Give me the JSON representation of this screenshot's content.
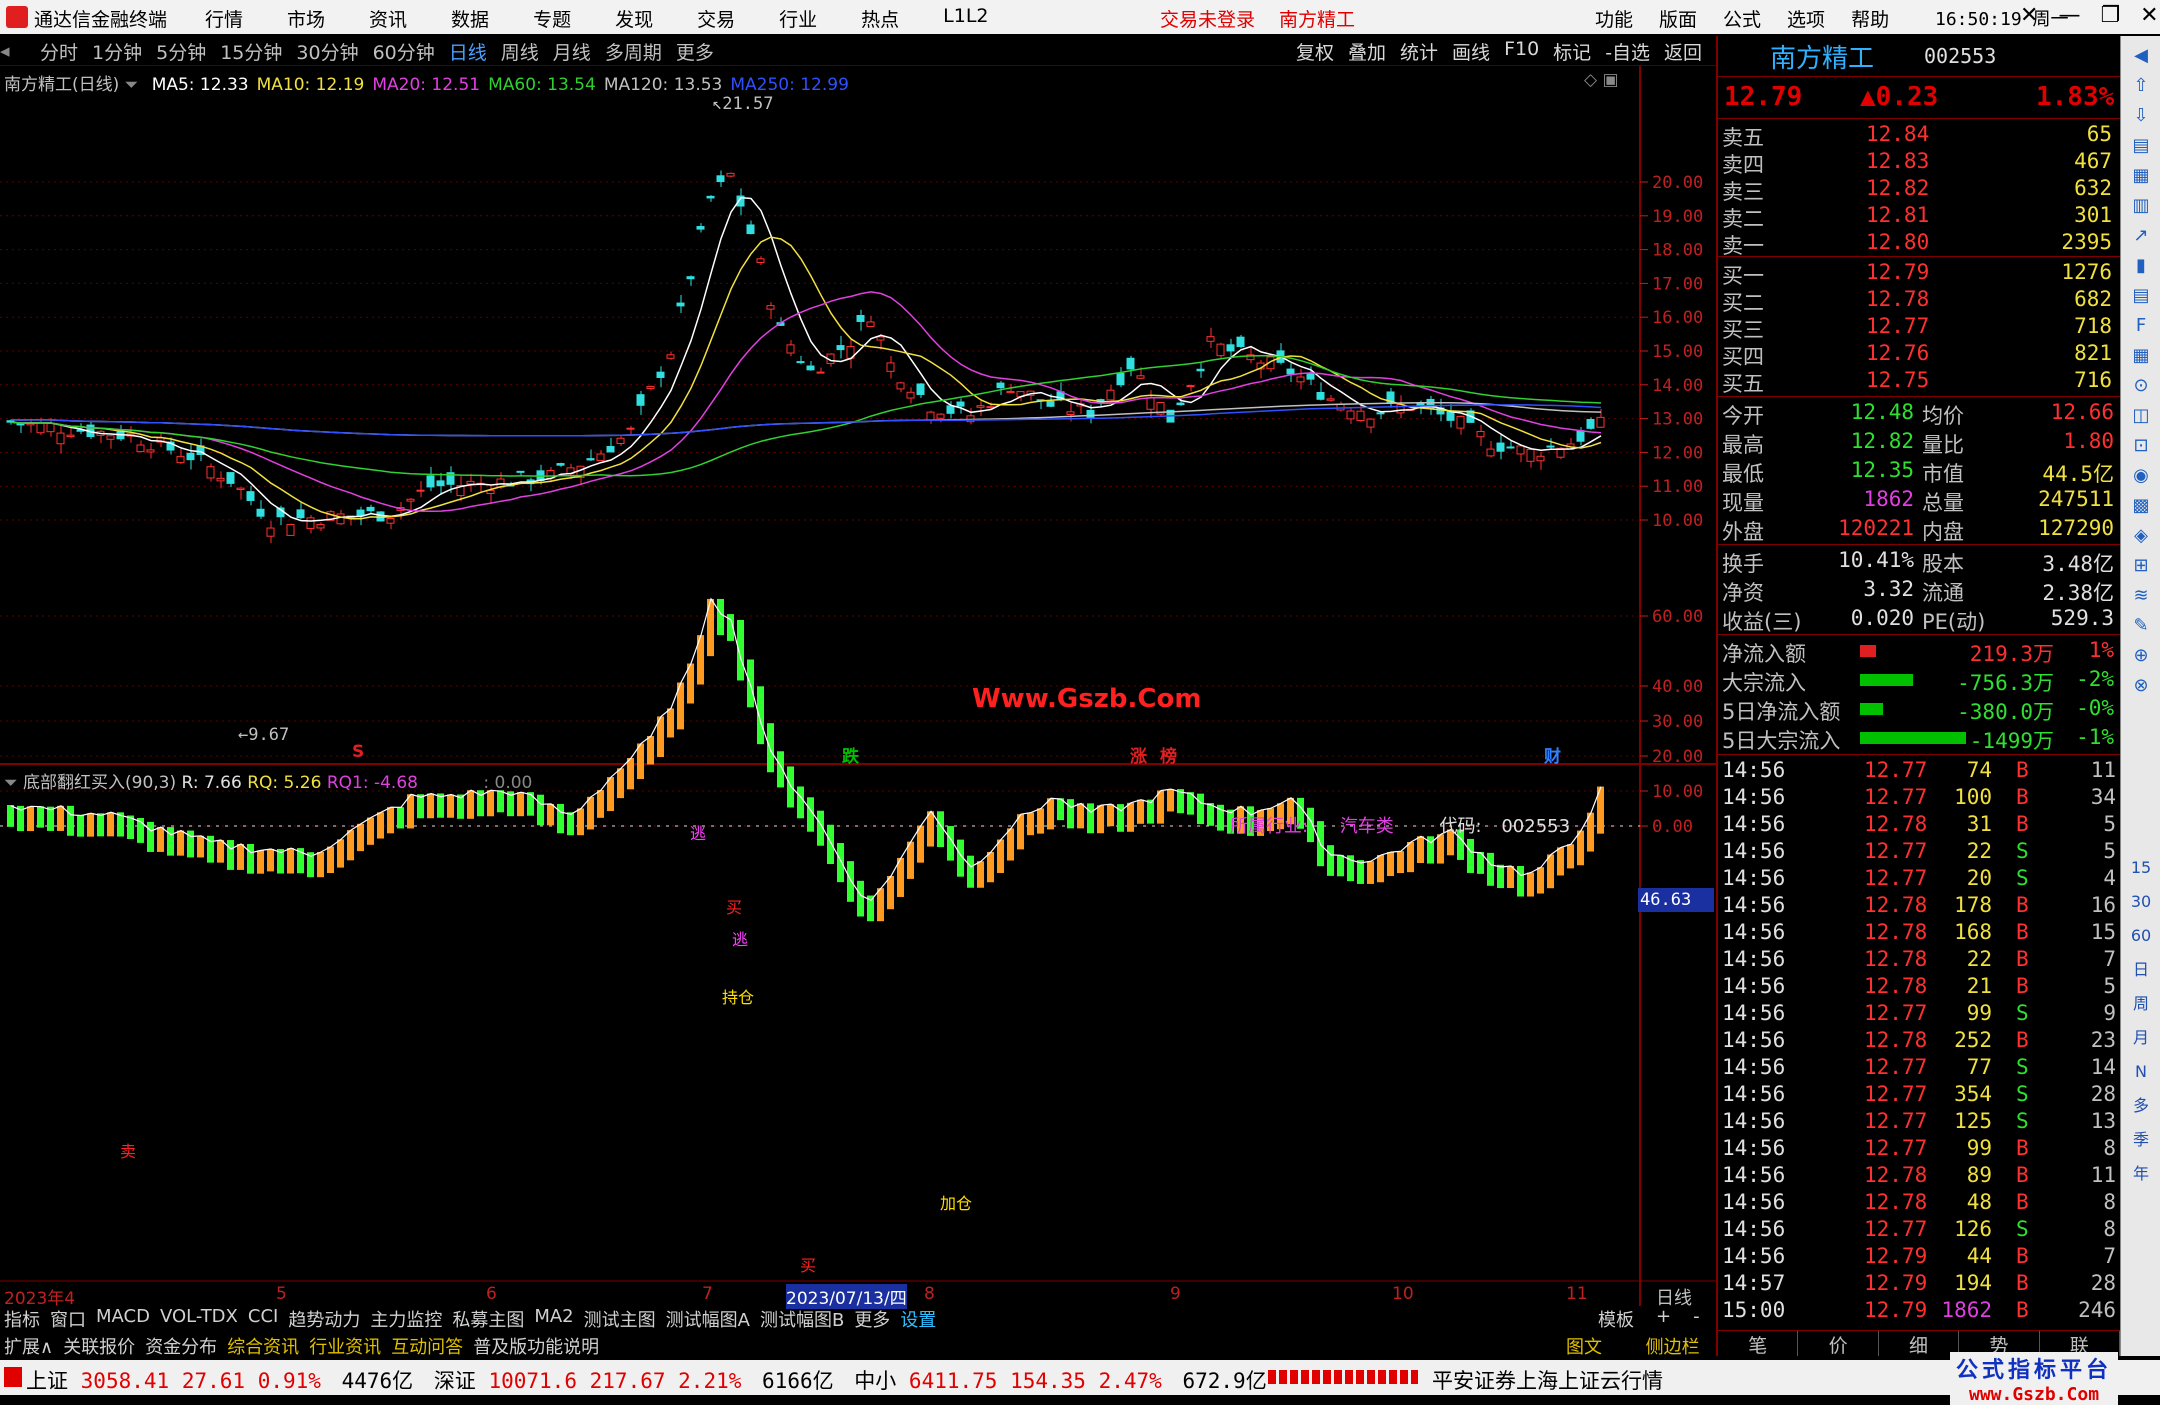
{
  "titlebar": {
    "app": "通达信金融终端",
    "menu": [
      "行情",
      "市场",
      "资讯",
      "数据",
      "专题",
      "发现",
      "交易",
      "行业",
      "热点",
      "L1L2"
    ],
    "login_status": "交易未登录",
    "stock_name": "南方精工",
    "right_menu": [
      "功能",
      "版面",
      "公式",
      "选项",
      "帮助"
    ],
    "clock": "16:50:19",
    "weekday": "周一"
  },
  "periods": {
    "items": [
      "分时",
      "1分钟",
      "5分钟",
      "15分钟",
      "30分钟",
      "60分钟",
      "日线",
      "周线",
      "月线",
      "多周期",
      "更多"
    ],
    "active": "日线",
    "tools": [
      "复权",
      "叠加",
      "统计",
      "画线",
      "F10",
      "标记",
      "-自选",
      "返回"
    ]
  },
  "main_chart": {
    "title": "南方精工(日线)",
    "ma": [
      {
        "label": "MA5: 12.33",
        "color": "#ffffff"
      },
      {
        "label": "MA10: 12.19",
        "color": "#f0e040"
      },
      {
        "label": "MA20: 12.51",
        "color": "#e040e0"
      },
      {
        "label": "MA60: 13.54",
        "color": "#30d030"
      },
      {
        "label": "MA120: 13.53",
        "color": "#c0c0c0"
      },
      {
        "label": "MA250: 12.99",
        "color": "#3050ff"
      }
    ],
    "high_mark": "21.57",
    "low_mark": "9.67",
    "watermark": "Www.Gszb.Com",
    "yticks": [
      "20.00",
      "19.00",
      "18.00",
      "17.00",
      "16.00",
      "15.00",
      "14.00",
      "13.00",
      "12.00",
      "11.00",
      "10.00"
    ],
    "event_marks": [
      {
        "text": "S",
        "color": "#e02020"
      },
      {
        "text": "跌",
        "color": "#00c000"
      },
      {
        "text": "涨",
        "color": "#e02020"
      },
      {
        "text": "榜",
        "color": "#e02020"
      },
      {
        "text": "财",
        "color": "#3080ff"
      }
    ]
  },
  "indicator": {
    "name": "底部翻红买入(90,3)",
    "r": "R: 7.66",
    "rq": "RQ: 5.26",
    "rq1": "RQ1: -4.68",
    "zero": ": 0.00",
    "industry_label": "所属行业:",
    "industry": "汽车类",
    "code_label": "代码:",
    "code": "002553",
    "current": "46.63",
    "yticks": [
      "60.00",
      "40.00",
      "30.00",
      "20.00",
      "10.00",
      "0.00"
    ],
    "labels": [
      "逃",
      "买",
      "逃",
      "持仓",
      "加仓",
      "卖",
      "买"
    ]
  },
  "time_axis": {
    "labels": [
      "2023年4",
      "5",
      "6",
      "7",
      "2023/07/13/四",
      "8",
      "9",
      "10",
      "11"
    ],
    "period": "日线"
  },
  "bottom_tabs": {
    "row1": [
      "指标",
      "窗口",
      "MACD",
      "VOL-TDX",
      "CCI",
      "趋势动力",
      "主力监控",
      "私募主图",
      "MA2",
      "测试主图",
      "测试幅图A",
      "测试幅图B",
      "更多",
      "设置"
    ],
    "row1_right": [
      "模板",
      "+",
      "-"
    ],
    "row2": [
      "扩展∧",
      "关联报价",
      "资金分布",
      "综合资讯",
      "行业资讯",
      "互动问答",
      "普及版功能说明"
    ],
    "row2_right": [
      "图文F10",
      "侧边栏《"
    ]
  },
  "quote": {
    "name": "南方精工",
    "code": "002553",
    "price": "12.79",
    "change": "▲0.23",
    "pct": "1.83%",
    "asks": [
      {
        "l": "卖五",
        "p": "12.84",
        "v": "65"
      },
      {
        "l": "卖四",
        "p": "12.83",
        "v": "467"
      },
      {
        "l": "卖三",
        "p": "12.82",
        "v": "632"
      },
      {
        "l": "卖二",
        "p": "12.81",
        "v": "301"
      },
      {
        "l": "卖一",
        "p": "12.80",
        "v": "2395"
      }
    ],
    "bids": [
      {
        "l": "买一",
        "p": "12.79",
        "v": "1276"
      },
      {
        "l": "买二",
        "p": "12.78",
        "v": "682"
      },
      {
        "l": "买三",
        "p": "12.77",
        "v": "718"
      },
      {
        "l": "买四",
        "p": "12.76",
        "v": "821"
      },
      {
        "l": "买五",
        "p": "12.75",
        "v": "716"
      }
    ],
    "stats": [
      {
        "a": "今开",
        "b": "12.48",
        "c": "均价",
        "d": "12.66"
      },
      {
        "a": "最高",
        "b": "12.82",
        "c": "量比",
        "d": "1.80"
      },
      {
        "a": "最低",
        "b": "12.35",
        "c": "市值",
        "d": "44.5亿"
      },
      {
        "a": "现量",
        "b": "1862",
        "c": "总量",
        "d": "247511"
      },
      {
        "a": "外盘",
        "b": "120221",
        "c": "内盘",
        "d": "127290"
      }
    ],
    "stats2": [
      {
        "a": "换手",
        "b": "10.41%",
        "c": "股本",
        "d": "3.48亿"
      },
      {
        "a": "净资",
        "b": "3.32",
        "c": "流通",
        "d": "2.38亿"
      },
      {
        "a": "收益(三)",
        "b": "0.020",
        "c": "PE(动)",
        "d": "529.3"
      }
    ],
    "flows": [
      {
        "l": "净流入额",
        "v": "219.3万",
        "p": "1%",
        "bar": 0.15,
        "c": "#e02020"
      },
      {
        "l": "大宗流入",
        "v": "-756.3万",
        "p": "-2%",
        "bar": 0.5,
        "c": "#00c000"
      },
      {
        "l": "5日净流入额",
        "v": "-380.0万",
        "p": "-0%",
        "bar": 0.22,
        "c": "#00c000"
      },
      {
        "l": "5日大宗流入",
        "v": "-1499万",
        "p": "-1%",
        "bar": 1.0,
        "c": "#00c000"
      }
    ],
    "ticks": [
      [
        "14:56",
        "12.77",
        "74",
        "B",
        "11"
      ],
      [
        "14:56",
        "12.77",
        "100",
        "B",
        "34"
      ],
      [
        "14:56",
        "12.78",
        "31",
        "B",
        "5"
      ],
      [
        "14:56",
        "12.77",
        "22",
        "S",
        "5"
      ],
      [
        "14:56",
        "12.77",
        "20",
        "S",
        "4"
      ],
      [
        "14:56",
        "12.78",
        "178",
        "B",
        "16"
      ],
      [
        "14:56",
        "12.78",
        "168",
        "B",
        "15"
      ],
      [
        "14:56",
        "12.78",
        "22",
        "B",
        "7"
      ],
      [
        "14:56",
        "12.78",
        "21",
        "B",
        "5"
      ],
      [
        "14:56",
        "12.77",
        "99",
        "S",
        "9"
      ],
      [
        "14:56",
        "12.78",
        "252",
        "B",
        "23"
      ],
      [
        "14:56",
        "12.77",
        "77",
        "S",
        "14"
      ],
      [
        "14:56",
        "12.77",
        "354",
        "S",
        "28"
      ],
      [
        "14:56",
        "12.77",
        "125",
        "S",
        "13"
      ],
      [
        "14:56",
        "12.77",
        "99",
        "B",
        "8"
      ],
      [
        "14:56",
        "12.78",
        "89",
        "B",
        "11"
      ],
      [
        "14:56",
        "12.78",
        "48",
        "B",
        "8"
      ],
      [
        "14:56",
        "12.77",
        "126",
        "S",
        "8"
      ],
      [
        "14:56",
        "12.79",
        "44",
        "B",
        "7"
      ],
      [
        "14:57",
        "12.79",
        "194",
        "B",
        "28"
      ],
      [
        "15:00",
        "12.79",
        "1862",
        "B",
        "246"
      ]
    ],
    "bottom_tabs": [
      "笔",
      "价",
      "细",
      "势",
      "联"
    ]
  },
  "sidebar_right": [
    "15",
    "30",
    "60",
    "日",
    "周",
    "月",
    "N",
    "多",
    "季",
    "年"
  ],
  "statusbar": {
    "sh_label": "上证",
    "sh": "3058.41",
    "sh_chg": "27.61",
    "sh_pct": "0.91%",
    "sh_amt": "4476亿",
    "sz_label": "深证",
    "sz": "10071.6",
    "sz_chg": "217.67",
    "sz_pct": "2.21%",
    "sz_amt": "6166亿",
    "zx_label": "中小",
    "zx": "6411.75",
    "zx_chg": "154.35",
    "zx_pct": "2.47%",
    "zx_amt": "672.9亿",
    "ticker": "平安证券上海上证云行情",
    "brand": "公式指标平台",
    "brand_url": "www.Gszb.Com"
  }
}
